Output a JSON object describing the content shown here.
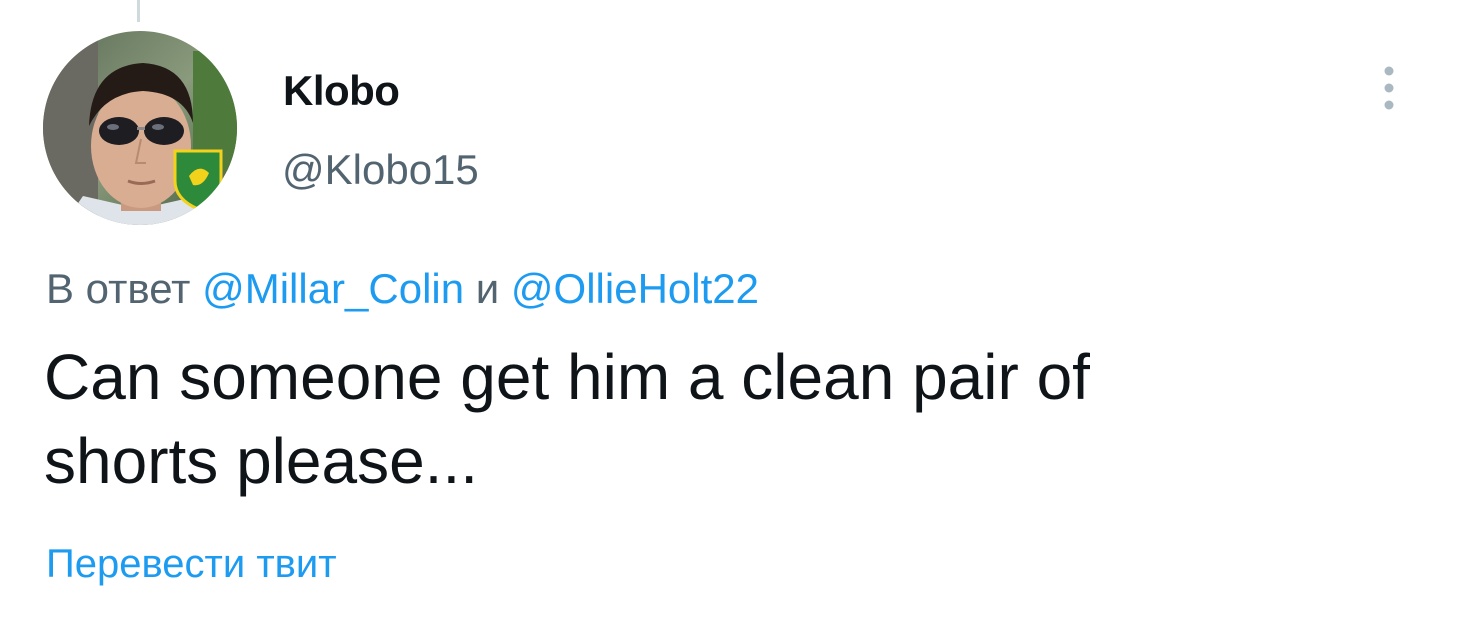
{
  "tweet": {
    "author": {
      "display_name": "Klobo",
      "handle": "@Klobo15",
      "avatar_icon": "user-avatar-photo"
    },
    "more_icon": "more-vertical-icon",
    "reply_to": {
      "prefix": "В ответ",
      "mention_1": "@Millar_Colin",
      "conjunction": "и",
      "mention_2": "@OllieHolt22"
    },
    "text_line_1": "Can someone get him a clean pair of",
    "text_line_2": "shorts please...",
    "translate_label": "Перевести твит"
  },
  "colors": {
    "text_primary": "#0f1419",
    "text_secondary": "#536471",
    "accent": "#1d9bf0",
    "thread_line": "#cfd9de"
  }
}
